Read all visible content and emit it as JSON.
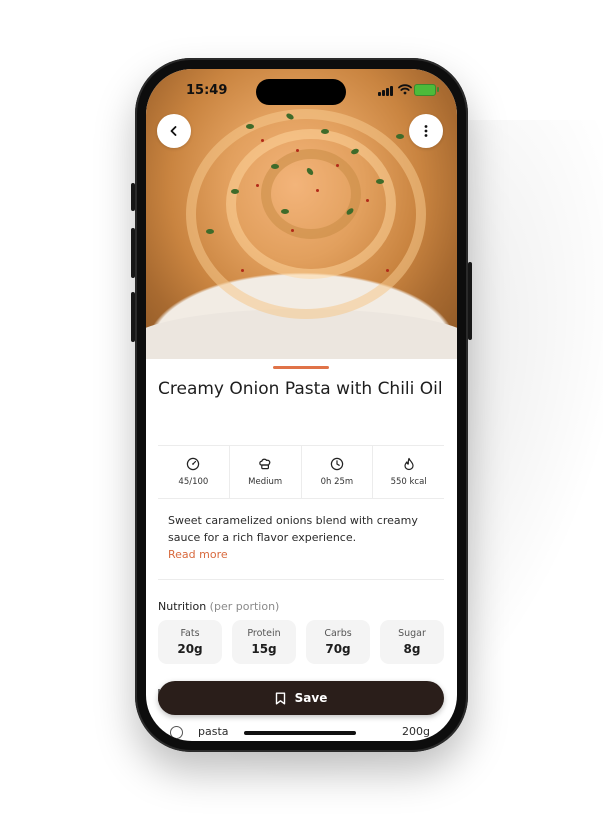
{
  "status": {
    "time": "15:49"
  },
  "recipe": {
    "title": "Creamy Onion Pasta with Chili Oil",
    "description": "Sweet caramelized onions blend with creamy sauce for a rich flavor experience.",
    "read_more": "Read more"
  },
  "stats": [
    {
      "icon": "speedometer-icon",
      "value": "45/100"
    },
    {
      "icon": "chef-hat-icon",
      "value": "Medium"
    },
    {
      "icon": "clock-icon",
      "value": "0h 25m"
    },
    {
      "icon": "flame-icon",
      "value": "550 kcal"
    }
  ],
  "nutrition": {
    "label": "Nutrition",
    "sublabel": "(per portion)",
    "items": [
      {
        "name": "Fats",
        "value": "20g"
      },
      {
        "name": "Protein",
        "value": "15g"
      },
      {
        "name": "Carbs",
        "value": "70g"
      },
      {
        "name": "Sugar",
        "value": "8g"
      }
    ]
  },
  "save_label": "Save",
  "ingredient": {
    "name": "pasta",
    "qty": "200g"
  },
  "colors": {
    "accent": "#e07348",
    "save_bg": "#2a1e1a",
    "battery": "#4cbb3a"
  }
}
